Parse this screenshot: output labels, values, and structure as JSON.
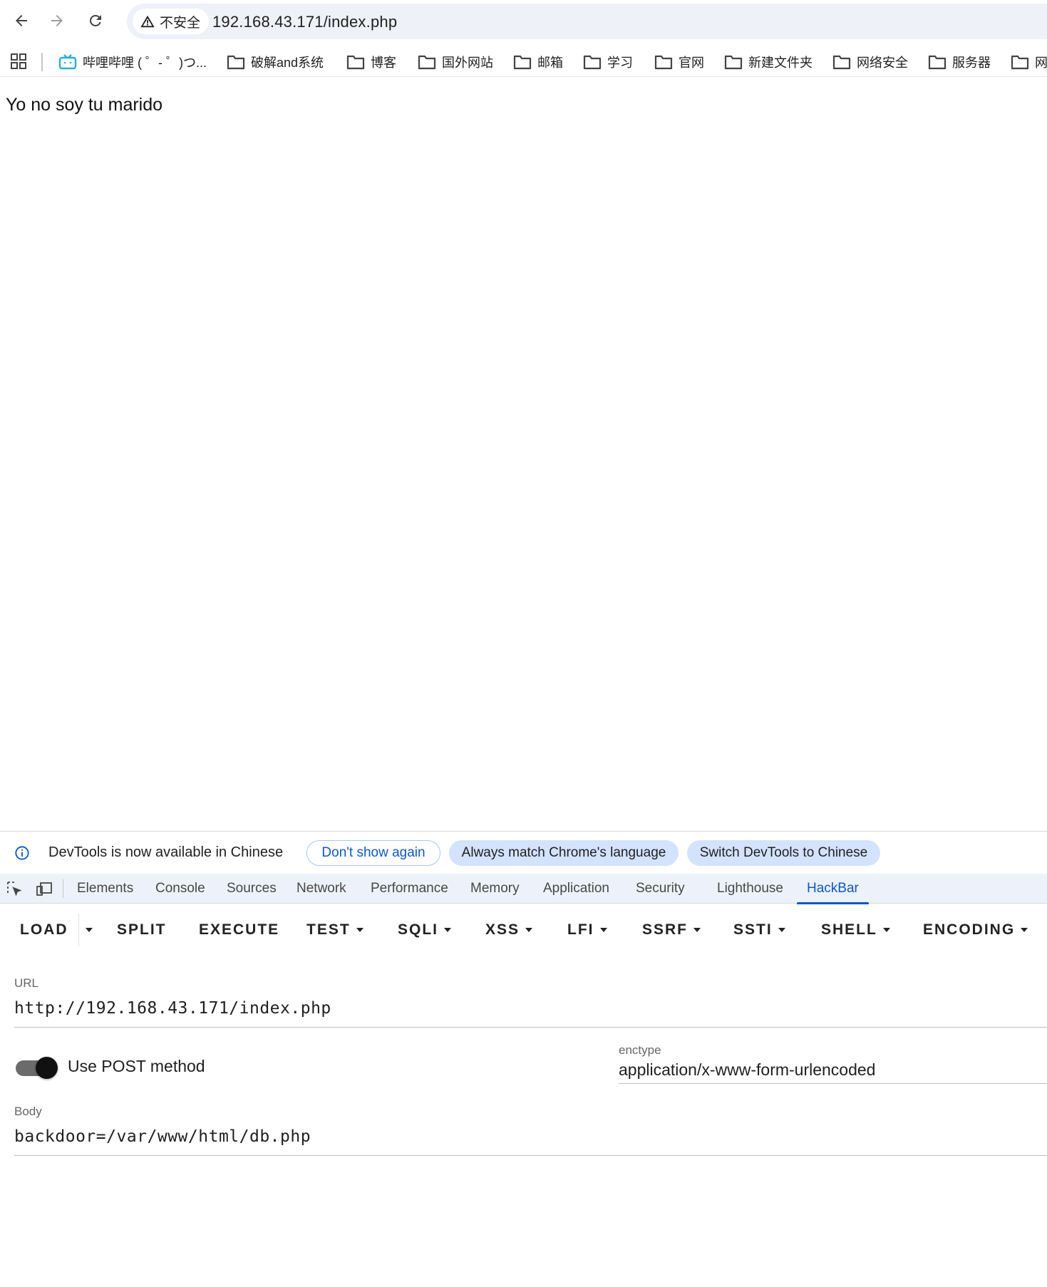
{
  "browser": {
    "security_chip": "不安全",
    "address": "192.168.43.171/index.php",
    "bookmarks": [
      "哔哩哔哩 ( ゜- ゜)つ...",
      "破解and系统",
      "博客",
      "国外网站",
      "邮箱",
      "学习",
      "官网",
      "新建文件夹",
      "网络安全",
      "服务器",
      "网"
    ]
  },
  "page": {
    "text": "Yo no soy tu marido"
  },
  "devtools": {
    "banner": {
      "message": "DevTools is now available in Chinese",
      "dont_show": "Don't show again",
      "always_match": "Always match Chrome's language",
      "switch": "Switch DevTools to Chinese"
    },
    "tabs": [
      "Elements",
      "Console",
      "Sources",
      "Network",
      "Performance",
      "Memory",
      "Application",
      "Security",
      "Lighthouse",
      "HackBar"
    ],
    "active_tab": "HackBar"
  },
  "hackbar": {
    "buttons": {
      "load": "LOAD",
      "split": "SPLIT",
      "execute": "EXECUTE",
      "test": "TEST",
      "sqli": "SQLI",
      "xss": "XSS",
      "lfi": "LFI",
      "ssrf": "SSRF",
      "ssti": "SSTI",
      "shell": "SHELL",
      "encoding": "ENCODING"
    },
    "url_label": "URL",
    "url_value": "http://192.168.43.171/index.php",
    "post_toggle_label": "Use POST method",
    "post_enabled": true,
    "enctype_label": "enctype",
    "enctype_value": "application/x-www-form-urlencoded",
    "body_label": "Body",
    "body_value": "backdoor=/var/www/html/db.php"
  },
  "colors": {
    "accent": "#0b57d0",
    "omnibox_bg": "#eef1f7",
    "devtools_tabs_bg": "#edf2fa",
    "pill_filled": "#d3e3fd",
    "bilibili_icon": "#23ade5"
  }
}
